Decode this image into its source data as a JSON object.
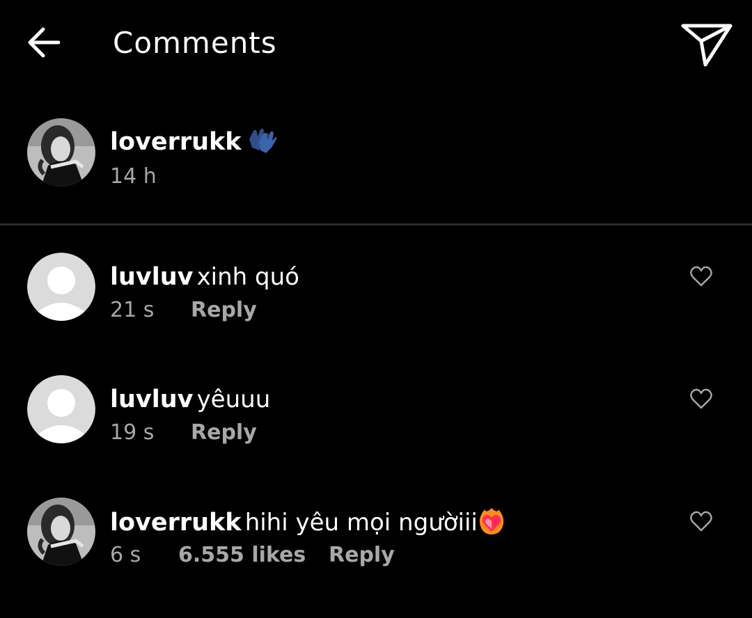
{
  "header": {
    "title": "Comments",
    "back_icon": "arrow-left-icon",
    "send_icon": "paper-plane-icon"
  },
  "caption": {
    "username": "loverrukk",
    "text": "",
    "emoji": "gloves-emoji",
    "time": "14 h"
  },
  "comments": [
    {
      "username": "luvluv",
      "text": "xinh quó",
      "time": "21 s",
      "likes": "",
      "reply_label": "Reply",
      "avatar": "default-avatar"
    },
    {
      "username": "luvluv",
      "text": "yêuuu",
      "time": "19 s",
      "likes": "",
      "reply_label": "Reply",
      "avatar": "default-avatar"
    },
    {
      "username": "loverrukk",
      "text": "hihi yêu mọi ngườiii",
      "emoji": "heart-on-fire-emoji",
      "time": "6 s",
      "likes": "6.555 likes",
      "reply_label": "Reply",
      "avatar": "profile-photo"
    }
  ],
  "colors": {
    "background": "#000000",
    "text": "#ffffff",
    "muted": "#a8a8a8",
    "divider": "#2b2b2b"
  }
}
